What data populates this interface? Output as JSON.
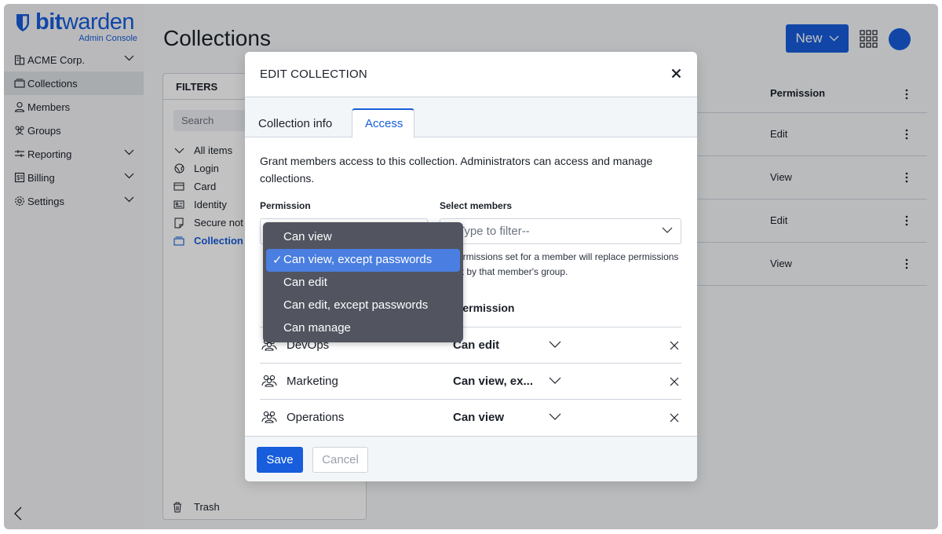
{
  "app": {
    "brand_bold": "bit",
    "brand_rest": "warden",
    "brand_sub": "Admin Console"
  },
  "sidebar": {
    "items": [
      {
        "label": "ACME Corp.",
        "has_chevron": true
      },
      {
        "label": "Collections",
        "active": true
      },
      {
        "label": "Members"
      },
      {
        "label": "Groups"
      },
      {
        "label": "Reporting",
        "has_chevron": true
      },
      {
        "label": "Billing",
        "has_chevron": true
      },
      {
        "label": "Settings",
        "has_chevron": true
      }
    ]
  },
  "header": {
    "title": "Collections",
    "new_label": "New"
  },
  "filters": {
    "title": "FILTERS",
    "search_placeholder": "Search",
    "items": [
      "All items",
      "Login",
      "Card",
      "Identity",
      "Secure not",
      "Collection"
    ],
    "trash_label": "Trash"
  },
  "table": {
    "permission_header": "Permission",
    "rows": [
      "Edit",
      "View",
      "Edit",
      "View"
    ]
  },
  "modal": {
    "title": "EDIT COLLECTION",
    "tabs": [
      "Collection info",
      "Access"
    ],
    "active_tab": "Access",
    "description": "Grant members access to this collection. Administrators can access and manage collections.",
    "permission_label": "Permission",
    "members_label": "Select members",
    "members_placeholder": "--Type to filter--",
    "hint_line1": "Permissions set for a member will replace permissions",
    "hint_line2": "set by that member's group.",
    "column_permission": "Permission",
    "access_rows": [
      {
        "name": "DevOps",
        "permission": "Can edit"
      },
      {
        "name": "Marketing",
        "permission": "Can view, ex..."
      },
      {
        "name": "Operations",
        "permission": "Can view"
      }
    ],
    "save_label": "Save",
    "cancel_label": "Cancel"
  },
  "dropdown": {
    "options": [
      "Can view",
      "Can view, except passwords",
      "Can edit",
      "Can edit, except passwords",
      "Can manage"
    ],
    "selected": "Can view, except passwords"
  },
  "colors": {
    "accent": "#175ddc",
    "dropdown_bg": "#525560",
    "dropdown_selected": "#4a7ee0"
  }
}
